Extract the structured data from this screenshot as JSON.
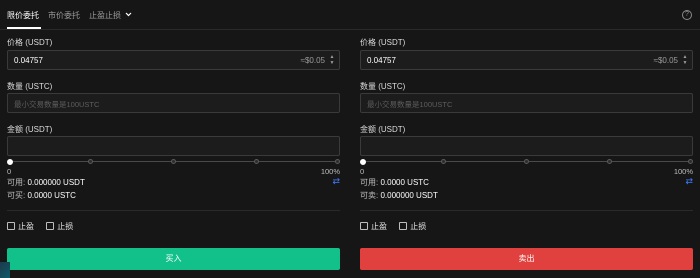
{
  "tabs": {
    "items": [
      {
        "label": "限价委托",
        "active": true
      },
      {
        "label": "市价委托",
        "active": false
      },
      {
        "label": "止盈止损",
        "active": false,
        "dropdown": true
      }
    ],
    "help_icon": "?"
  },
  "buy_panel": {
    "price_label": "价格 (USDT)",
    "price_value": "0.04757",
    "price_converted": "≈$0.05",
    "qty_label": "数量 (USTC)",
    "qty_placeholder": "最小交易数量是100USTC",
    "amount_label": "金额 (USDT)",
    "slider_min": "0",
    "slider_max": "100%",
    "slider_percent": 0,
    "available_label": "可用:",
    "available_value": "0.000000 USDT",
    "buyable_label": "可买:",
    "buyable_value": "0.0000 USTC",
    "tp_label": "止盈",
    "sl_label": "止损",
    "submit_label": "买入"
  },
  "sell_panel": {
    "price_label": "价格 (USDT)",
    "price_value": "0.04757",
    "price_converted": "≈$0.05",
    "qty_label": "数量 (USTC)",
    "qty_placeholder": "最小交易数量是100USTC",
    "amount_label": "金额 (USDT)",
    "slider_min": "0",
    "slider_max": "100%",
    "slider_percent": 0,
    "available_label": "可用:",
    "available_value": "0.0000 USTC",
    "sellable_label": "可卖:",
    "sellable_value": "0.000000 USDT",
    "tp_label": "止盈",
    "sl_label": "止损",
    "submit_label": "卖出"
  },
  "colors": {
    "buy": "#12c08a",
    "sell": "#e0413e",
    "accent": "#3d7bff",
    "background": "#161616"
  }
}
